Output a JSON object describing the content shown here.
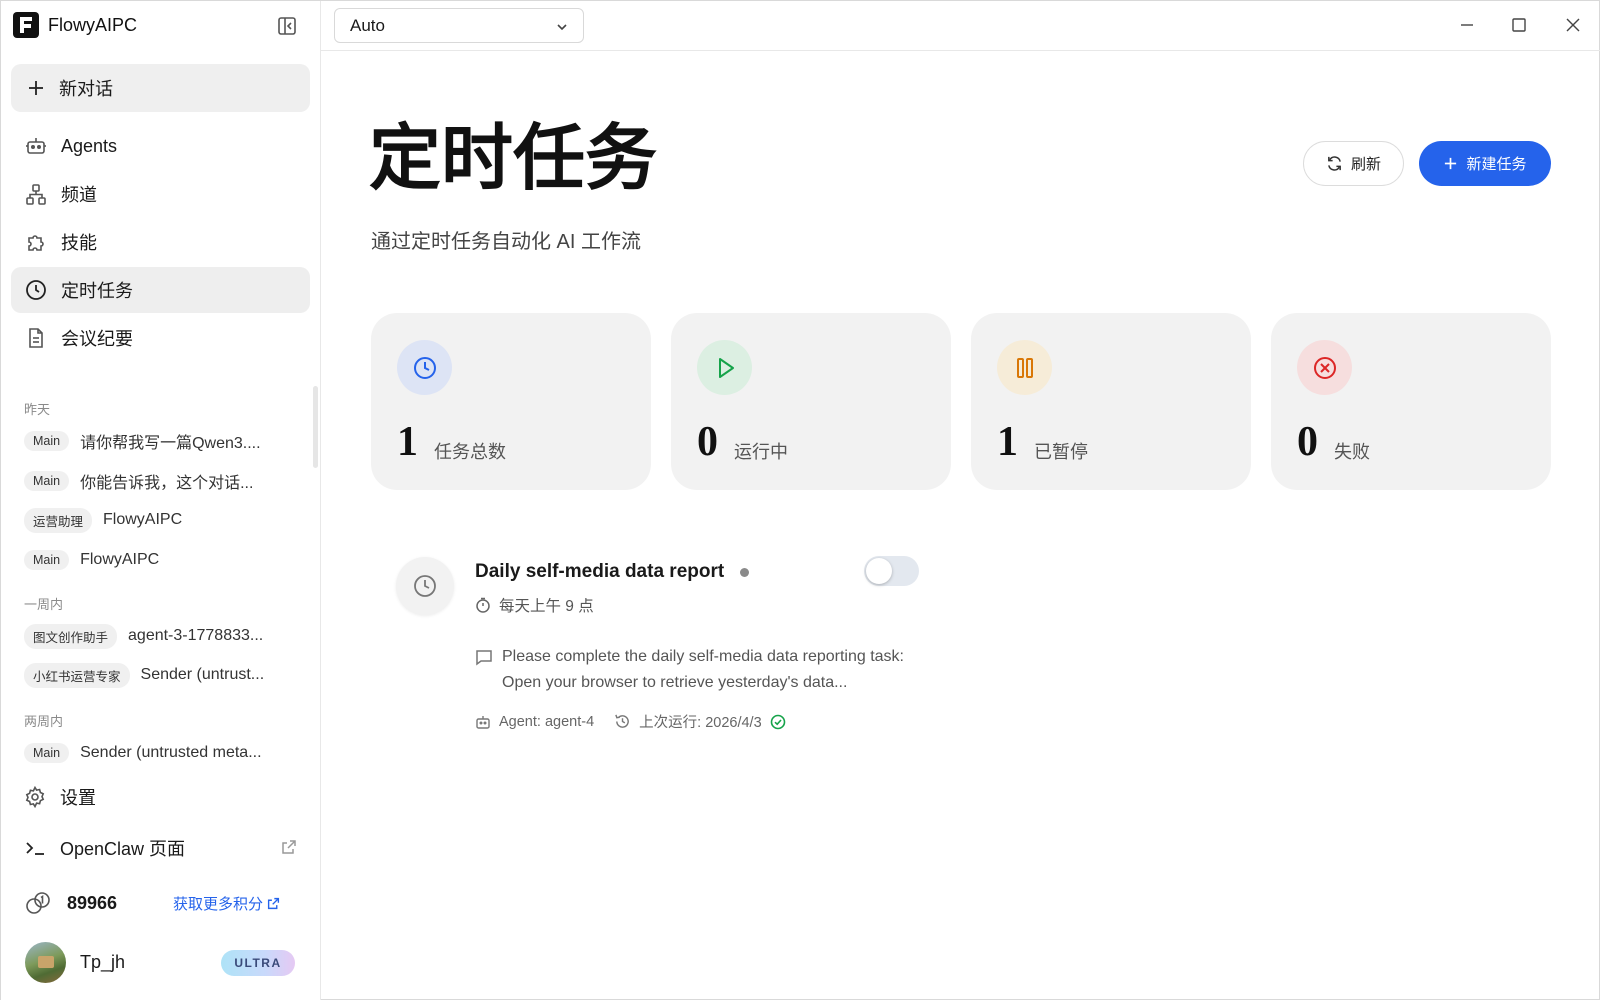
{
  "app": {
    "name": "FlowyAIPC"
  },
  "sidebar": {
    "new_chat": "新对话",
    "nav": [
      {
        "label": "Agents",
        "icon": "robot-icon"
      },
      {
        "label": "频道",
        "icon": "network-icon"
      },
      {
        "label": "技能",
        "icon": "puzzle-icon"
      },
      {
        "label": "定时任务",
        "icon": "clock-icon",
        "active": true
      },
      {
        "label": "会议纪要",
        "icon": "document-icon"
      }
    ],
    "sections": [
      {
        "title": "昨天",
        "items": [
          {
            "tag": "Main",
            "title": "请你帮我写一篇Qwen3...."
          },
          {
            "tag": "Main",
            "title": "你能告诉我，这个对话..."
          },
          {
            "tag": "运营助理",
            "title": "FlowyAIPC"
          },
          {
            "tag": "Main",
            "title": "FlowyAIPC"
          }
        ]
      },
      {
        "title": "一周内",
        "items": [
          {
            "tag": "图文创作助手",
            "title": "agent-3-1778833..."
          },
          {
            "tag": "小红书运营专家",
            "title": "Sender (untrust..."
          }
        ]
      },
      {
        "title": "两周内",
        "items": [
          {
            "tag": "Main",
            "title": "Sender (untrusted meta..."
          }
        ]
      }
    ],
    "settings": "设置",
    "openclaw": "OpenClaw 页面",
    "credits": {
      "value": "89966",
      "more": "获取更多积分"
    },
    "user": {
      "name": "Tp_jh",
      "badge": "ULTRA"
    }
  },
  "topbar": {
    "model": "Auto"
  },
  "main": {
    "title": "定时任务",
    "subtitle": "通过定时任务自动化 AI 工作流",
    "refresh": "刷新",
    "new_task": "新建任务",
    "stats": [
      {
        "value": "1",
        "label": "任务总数",
        "color": "#2563eb",
        "bg": "#dde4f5",
        "icon": "clock-icon"
      },
      {
        "value": "0",
        "label": "运行中",
        "color": "#16a34a",
        "bg": "#dcefe2",
        "icon": "play-icon"
      },
      {
        "value": "1",
        "label": "已暂停",
        "color": "#d97706",
        "bg": "#f6ecd8",
        "icon": "pause-icon"
      },
      {
        "value": "0",
        "label": "失败",
        "color": "#dc2626",
        "bg": "#f6dede",
        "icon": "x-circle-icon"
      }
    ],
    "task": {
      "name": "Daily self-media data report",
      "schedule": "每天上午 9 点",
      "description": "Please complete the daily self-media data reporting task: Open your browser to retrieve yesterday's data...",
      "agent": "Agent: agent-4",
      "last_run": "上次运行: 2026/4/3",
      "enabled": false
    }
  }
}
